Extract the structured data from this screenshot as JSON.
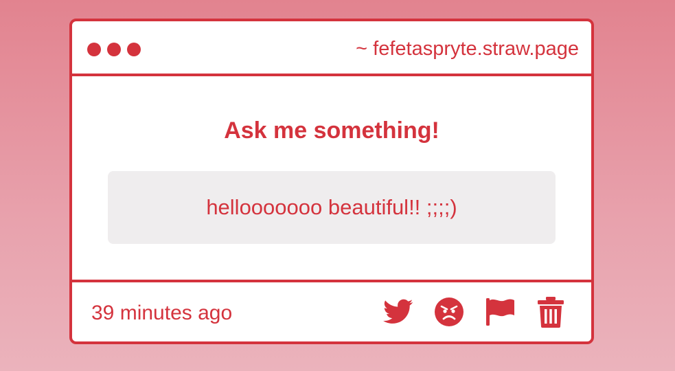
{
  "window": {
    "url": "~ fefetaspryte.straw.page"
  },
  "main": {
    "title": "Ask me something!",
    "question": "hellooooooo beautiful!! ;;;;)"
  },
  "footer": {
    "timestamp": "39 minutes ago"
  },
  "icons": {
    "share": "twitter-icon",
    "react": "angry-face-icon",
    "report": "flag-icon",
    "delete": "trash-icon"
  },
  "colors": {
    "accent": "#d4333d",
    "question_bg": "#efedee",
    "card_bg": "#ffffff"
  }
}
